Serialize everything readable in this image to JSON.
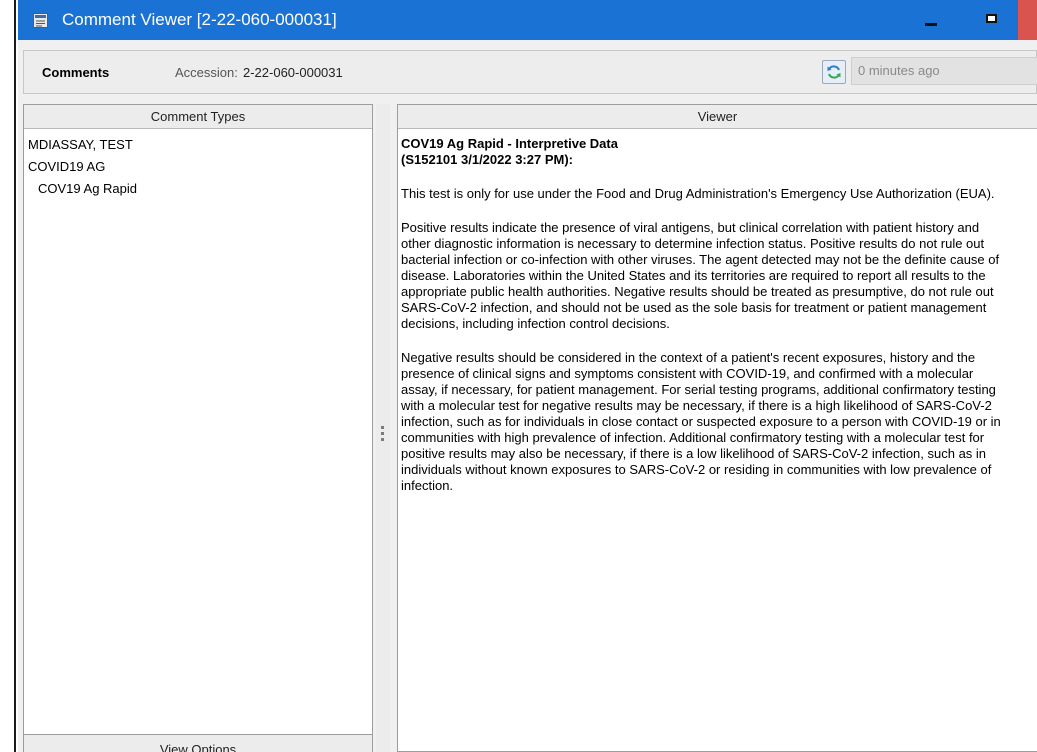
{
  "window": {
    "title": "Comment Viewer [2-22-060-000031]",
    "titlebar_color": "#1a73d4"
  },
  "header": {
    "section_label": "Comments",
    "accession_label": "Accession:",
    "accession_value": "2-22-060-000031",
    "refresh_icon": "refresh-icon",
    "last_updated": "0 minutes ago"
  },
  "left_panel": {
    "header": "Comment Types",
    "items": [
      {
        "label": "MDIASSAY, TEST",
        "level": 0
      },
      {
        "label": "COVID19 AG",
        "level": 0
      },
      {
        "label": "COV19 Ag Rapid",
        "level": 1
      }
    ],
    "footer_button": "View Options"
  },
  "viewer": {
    "header": "Viewer",
    "comment_title": "COV19 Ag Rapid - Interpretive Data",
    "comment_meta": "(S152101 3/1/2022 3:27 PM):",
    "paragraphs": [
      "This test is only for use under the Food and Drug Administration's Emergency Use Authorization (EUA).",
      "Positive results indicate the presence of viral antigens, but clinical correlation with patient history and other diagnostic information is necessary to determine infection status. Positive results do not rule out bacterial infection or co-infection with other viruses. The agent detected may not be the definite cause of disease. Laboratories within the United States and its territories are required to report all results to the appropriate public health authorities. Negative results should be treated as presumptive, do not rule out SARS-CoV-2 infection, and should not be used as the sole basis for treatment or patient management decisions, including infection control decisions.",
      "Negative results should be considered in the context of a patient's recent exposures, history and the presence of clinical signs and symptoms consistent with COVID-19, and confirmed with a molecular assay, if necessary, for patient management. For serial testing programs, additional confirmatory testing with a molecular test for negative results may be necessary, if there is a high likelihood of SARS-CoV-2 infection, such as for individuals in close contact or suspected exposure to a person with COVID-19 or in communities with high prevalence of infection. Additional confirmatory testing with a molecular test for positive results may also be necessary, if there is a low likelihood of SARS-CoV-2 infection, such as in individuals without known exposures to SARS-CoV-2 or residing in communities with low prevalence of infection."
    ]
  }
}
